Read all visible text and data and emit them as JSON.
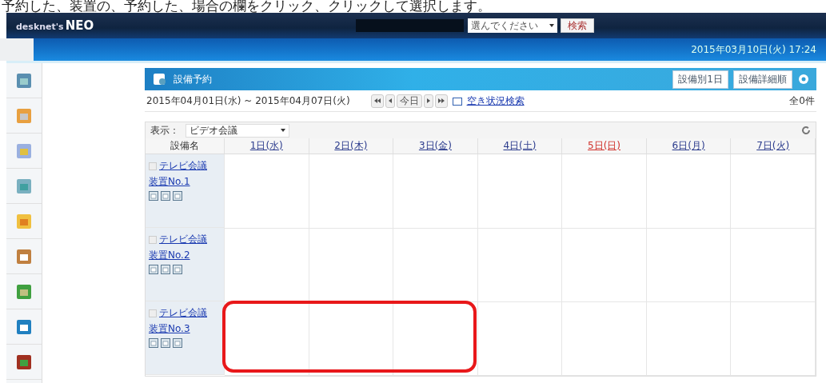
{
  "caption": "予約した、装置の、予約した、場合の欄をクリック、クリックして選択します。",
  "header": {
    "logo_prefix": "desknet's",
    "logo_main": "NEO",
    "select_placeholder": "選んでください",
    "search_button": "検索"
  },
  "datetime": "2015年03月10日(火) 17:24",
  "panel": {
    "title": "設備予約",
    "buttons": [
      "設備別1日",
      "設備詳細順"
    ],
    "range": "2015年04月01日(水) ~ 2015年04月07日(火)",
    "today": "今日",
    "availability_link": "空き状況検索",
    "count": "全0件",
    "filter_label": "表示：",
    "filter_value": "ビデオ会議",
    "columns": [
      {
        "label": "設備名",
        "kind": "name"
      },
      {
        "label": "1日(水)",
        "kind": "weekday"
      },
      {
        "label": "2日(木)",
        "kind": "weekday"
      },
      {
        "label": "3日(金)",
        "kind": "weekday"
      },
      {
        "label": "4日(土)",
        "kind": "saturday"
      },
      {
        "label": "5日(日)",
        "kind": "sunday"
      },
      {
        "label": "6日(月)",
        "kind": "weekday"
      },
      {
        "label": "7日(火)",
        "kind": "weekday"
      }
    ],
    "rows": [
      {
        "name": "テレビ会議",
        "name2": "装置No.1",
        "checked": false,
        "highlighted": false
      },
      {
        "name": "テレビ会議",
        "name2": "装置No.2",
        "checked": false,
        "highlighted": false
      },
      {
        "name": "テレビ会議",
        "name2": "装置No.3",
        "checked": false,
        "highlighted": true
      }
    ]
  }
}
